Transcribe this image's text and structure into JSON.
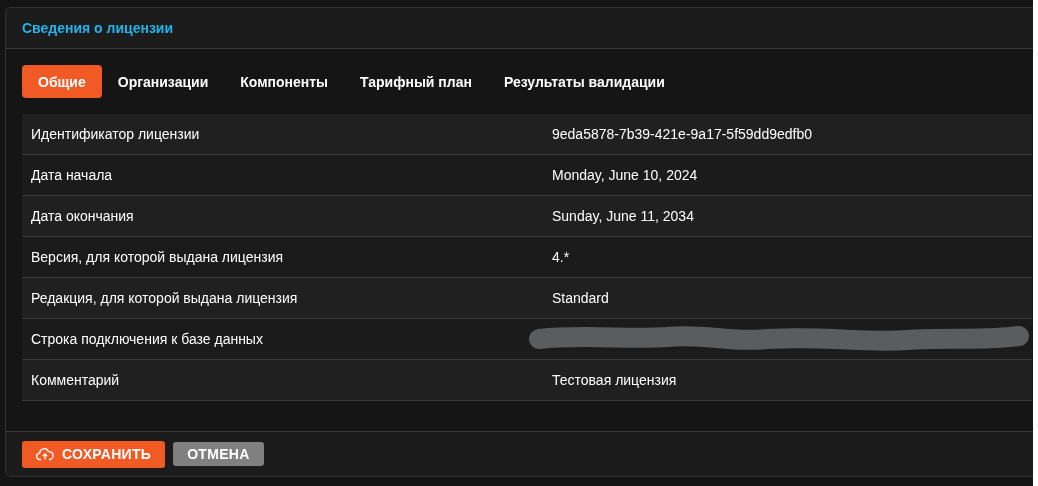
{
  "panel": {
    "title": "Сведения о лицензии"
  },
  "tabs": [
    {
      "label": "Общие",
      "selected": true
    },
    {
      "label": "Организации",
      "selected": false
    },
    {
      "label": "Компоненты",
      "selected": false
    },
    {
      "label": "Тарифный план",
      "selected": false
    },
    {
      "label": "Результаты валидации",
      "selected": false
    }
  ],
  "rows": [
    {
      "label": "Идентификатор лицензии",
      "value": "9eda5878-7b39-421e-9a17-5f59dd9edfb0"
    },
    {
      "label": "Дата начала",
      "value": "Monday, June 10, 2024"
    },
    {
      "label": "Дата окончания",
      "value": "Sunday, June 11, 2034"
    },
    {
      "label": "Версия, для которой выдана лицензия",
      "value": "4.*"
    },
    {
      "label": "Редакция, для которой выдана лицензия",
      "value": "Standard"
    },
    {
      "label": "Строка подключения к базе данных",
      "redacted": true
    },
    {
      "label": "Комментарий",
      "value": "Тестовая лицензия"
    }
  ],
  "buttons": [
    {
      "label": "СОХРАНИТЬ",
      "kind": "primary"
    },
    {
      "label": "ОТМЕНА",
      "kind": "secondary"
    }
  ]
}
